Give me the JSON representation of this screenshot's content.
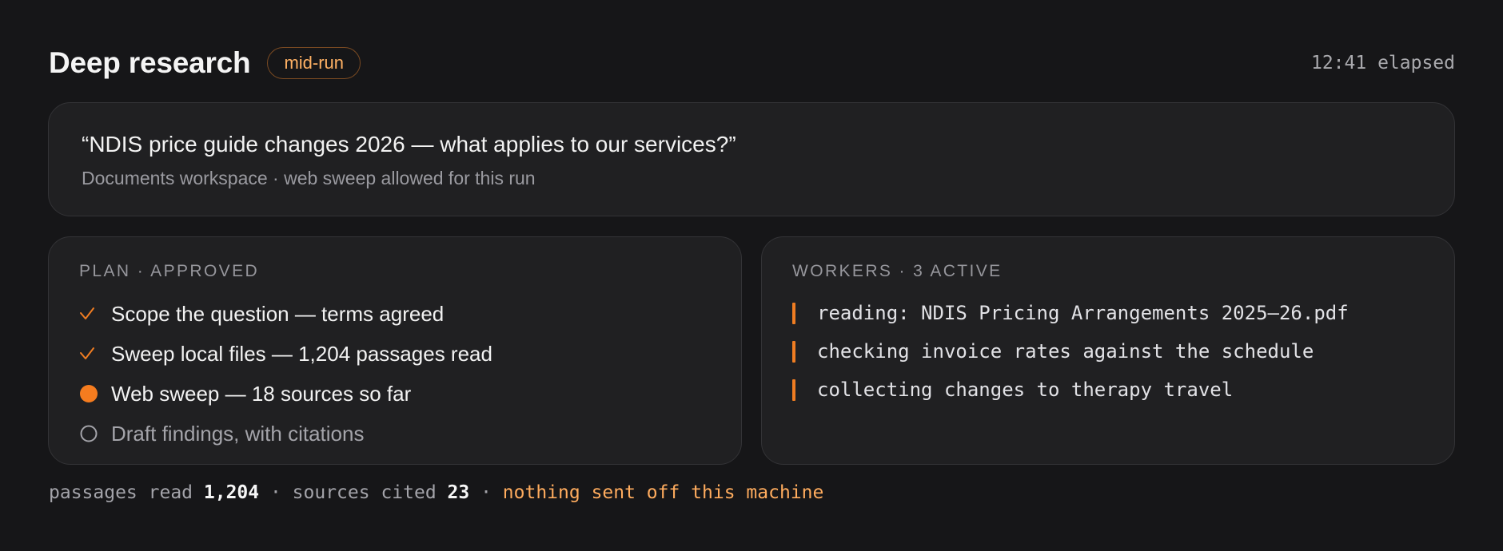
{
  "header": {
    "title": "Deep research",
    "badge": "mid-run",
    "elapsed": "12:41 elapsed"
  },
  "query": {
    "text": "“NDIS price guide changes 2026 — what applies to our services?”",
    "meta": "Documents workspace · web sweep allowed for this run"
  },
  "plan": {
    "label": "PLAN · APPROVED",
    "items": [
      {
        "label": "Scope the question — terms agreed",
        "status": "done",
        "icon": "check-icon"
      },
      {
        "label": "Sweep local files — 1,204 passages read",
        "status": "done",
        "icon": "check-icon"
      },
      {
        "label": "Web sweep — 18 sources so far",
        "status": "active",
        "icon": "active-dot-icon"
      },
      {
        "label": "Draft findings, with citations",
        "status": "pending",
        "icon": "empty-circle-icon"
      }
    ]
  },
  "workers": {
    "label": "WORKERS · 3 ACTIVE",
    "items": [
      {
        "text": "reading: NDIS Pricing Arrangements 2025–26.pdf"
      },
      {
        "text": "checking invoice rates against the schedule"
      },
      {
        "text": "collecting changes to therapy travel"
      }
    ]
  },
  "footer": {
    "passages_label": "passages read ",
    "passages_value": "1,204",
    "sep1": " · ",
    "sources_label": "sources cited ",
    "sources_value": "23",
    "sep2": " · ",
    "note": "nothing sent off this machine"
  },
  "colors": {
    "background": "#161618",
    "card": "#202022",
    "accent": "#f07d22",
    "accent_text": "#ffb164",
    "muted": "#9a9aa0"
  }
}
